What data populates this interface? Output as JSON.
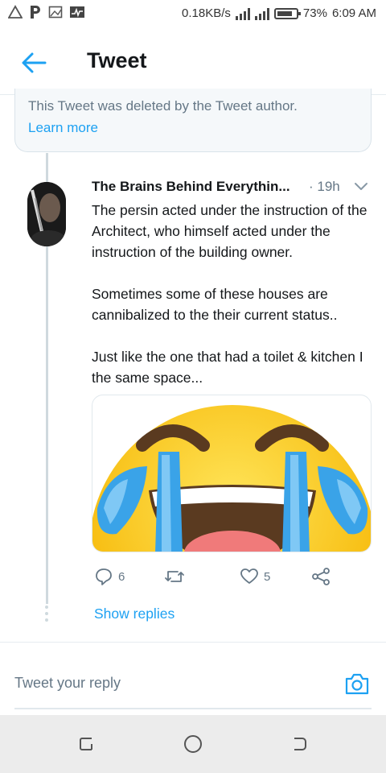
{
  "status_bar": {
    "network_speed": "0.18KB/s",
    "battery": "73%",
    "time": "6:09 AM",
    "left_icons": [
      "warning-triangle-icon",
      "parking-icon",
      "image-icon",
      "activity-icon"
    ]
  },
  "header": {
    "title": "Tweet",
    "back_icon": "arrow-left-icon"
  },
  "deleted_notice": {
    "text": "This Tweet was deleted by the Tweet author.",
    "link": "Learn more"
  },
  "tweet": {
    "author": "The Brains Behind Everythin...",
    "time": "· 19h",
    "body": [
      "The persin acted under the instruction of the Architect, who himself acted under the instruction of the building owner.",
      "Sometimes some of these houses are cannibalized to the their current status..",
      "Just like the one that had a toilet & kitchen I  the same space..."
    ],
    "media": "crying-laughing-emoji",
    "actions": {
      "reply_count": "6",
      "retweet_count": "",
      "like_count": "5"
    },
    "show_replies": "Show replies"
  },
  "reply_bar": {
    "placeholder": "Tweet your reply"
  },
  "colors": {
    "accent": "#1da1f2",
    "muted": "#657786",
    "text": "#14171a"
  }
}
